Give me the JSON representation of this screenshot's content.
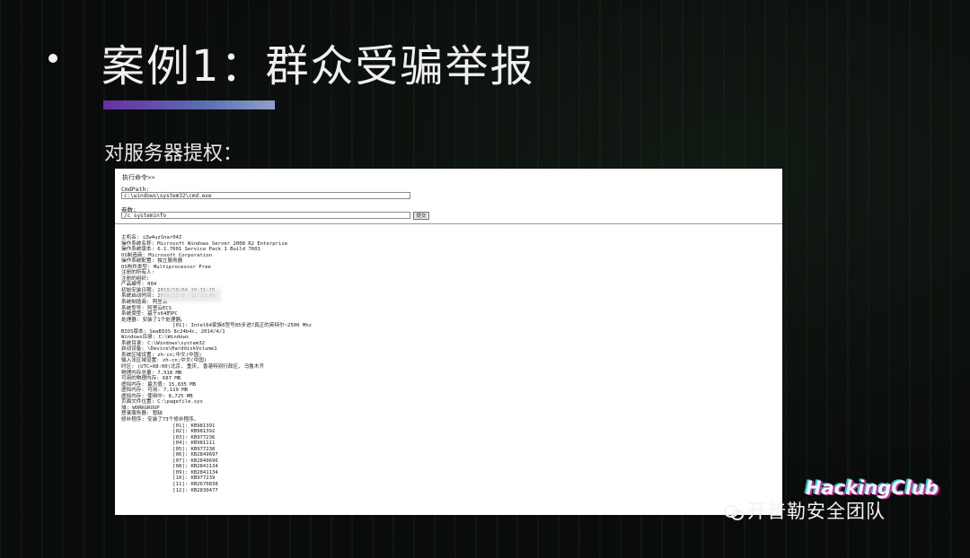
{
  "slide": {
    "title": "案例1：群众受骗举报",
    "subtitle": "对服务器提权："
  },
  "screenshot": {
    "header": "执行命令>>",
    "cmd_path_label": "CmdPath:",
    "cmd_path_value": "c:\\windows\\system32\\cmd.exe",
    "params_label": "参数:",
    "params_value": "/c systeminfo",
    "submit_label": "提交",
    "output_lines": [
      "主机名: iZw4uzSnar04Z",
      "操作系统名称: Microsoft Windows Server 2008 R2 Enterprise",
      "操作系统版本: 6.1.7601 Service Pack 1 Build 7601",
      "OS制造商: Microsoft Corporation",
      "操作系统配置: 独立服务器",
      "OS构件类型: Multiprocessor Free",
      "注册的所有人:",
      "注册的组织:",
      "产品编号: 004",
      "初始安装日期: 2019/10/04 10:11:15",
      "系统启动时间: 2019/12/9, 12:12:45",
      "系统制造商: 阿里云",
      "系统型号: 阿里云ECS",
      "系统类型: 基于x64的PC",
      "处理器: 安装了1个处理器。",
      "                 [01]: Intel64家族6型号85步进7真正的英特尔~2500 Mhz",
      "BIOS版本: SeaBIOS 8c24b4c, 2014/4/1",
      "Windows目录: C:\\Windows",
      "系统目录: C:\\Windows\\system32",
      "启动设备: \\Device\\HarddiskVolume1",
      "系统区域设置: zh-cn;中文(中国)",
      "输入法区域设置: zh-cn;中文(中国)",
      "时区: (UTC+08:00)北京, 重庆, 香港特别行政区, 乌鲁木齐",
      "物理内存总量: 7,918 MB",
      "可用的物理内存: 687 MB",
      "虚拟内存: 最大值: 15,835 MB",
      "虚拟内存: 可用: 7,110 MB",
      "虚拟内存: 使用中: 8,725 MB",
      "页面文件位置: C:\\pagefile.sys",
      "域: WORKGROUP",
      "登录服务器: 暂缺",
      "修补程序: 安装了73个修补程序。",
      "                 [01]: KB981391",
      "                 [02]: KB981392",
      "                 [03]: KB977236",
      "                 [04]: KB981111",
      "                 [05]: KB977238",
      "                 [06]: KB2849697",
      "                 [07]: KB2849696",
      "                 [08]: KB2841134",
      "                 [09]: KB2841134",
      "                 [10]: KB977239",
      "                 [11]: KB2670838",
      "                 [12]: KB2830477"
    ]
  },
  "watermark": {
    "text": "开普勒安全团队",
    "icon": "wechat-icon"
  },
  "logo": {
    "text": "HackingClub"
  }
}
